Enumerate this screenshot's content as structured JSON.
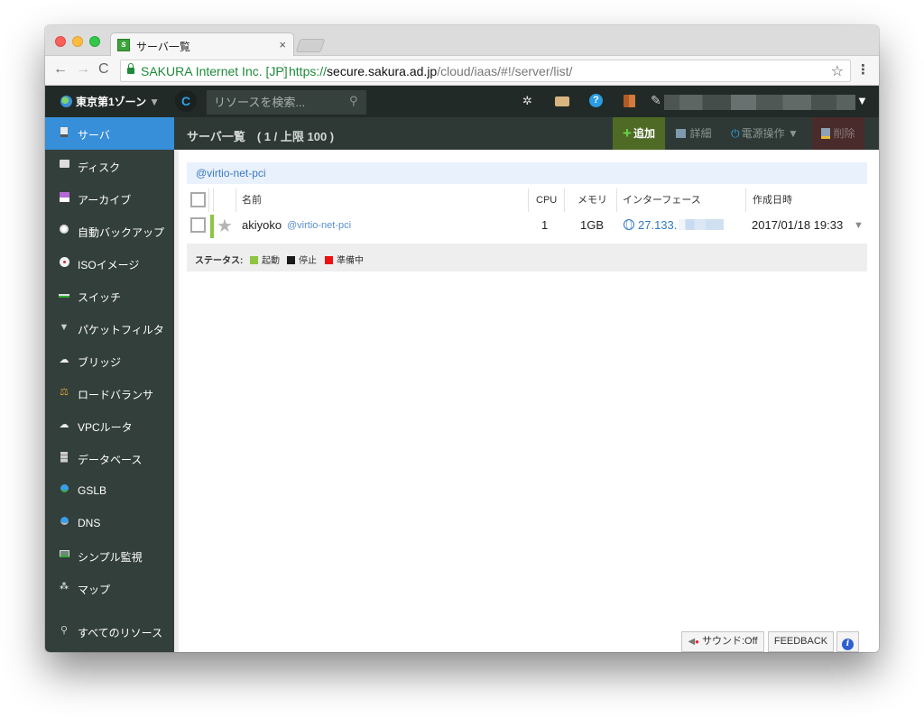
{
  "browser": {
    "tab_title": "サーバ一覧",
    "tab_close": "×",
    "ev_name": "SAKURA Internet Inc. [JP]",
    "url_scheme": "https://",
    "url_host": "secure.sakura.ad.jp",
    "url_path": "/cloud/iaas/#!/server/list/",
    "back": "←",
    "forward": "→",
    "reload": "C",
    "star": "☆",
    "menu": "⋮"
  },
  "topbar": {
    "zone": "東京第1ゾーン",
    "zone_caret": "▼",
    "reload_label": "C",
    "search_placeholder": "リソースを検索...",
    "search_icon": "⚲",
    "gear": "✲",
    "help": "?",
    "feather": "✎",
    "user_caret": "▼"
  },
  "sidebar": {
    "items": [
      {
        "label": "サーバ",
        "icon": "server-icon",
        "active": true
      },
      {
        "label": "ディスク",
        "icon": "disk-icon"
      },
      {
        "label": "アーカイブ",
        "icon": "archive-icon"
      },
      {
        "label": "自動バックアップ",
        "icon": "clock-icon"
      },
      {
        "label": "ISOイメージ",
        "icon": "cd-icon"
      },
      {
        "label": "スイッチ",
        "icon": "switch-icon"
      },
      {
        "label": "パケットフィルタ",
        "icon": "filter-icon"
      },
      {
        "label": "ブリッジ",
        "icon": "bridge-icon"
      },
      {
        "label": "ロードバランサ",
        "icon": "balance-icon"
      },
      {
        "label": "VPCルータ",
        "icon": "router-icon"
      },
      {
        "label": "データベース",
        "icon": "database-icon"
      },
      {
        "label": "GSLB",
        "icon": "gslb-icon"
      },
      {
        "label": "DNS",
        "icon": "dns-icon"
      },
      {
        "label": "シンプル監視",
        "icon": "monitor-icon"
      },
      {
        "label": "マップ",
        "icon": "map-icon"
      },
      {
        "label": "すべてのリソース",
        "icon": "search-icon"
      }
    ]
  },
  "content": {
    "title": "サーバ一覧　( 1 / 上限 100 )",
    "actions": {
      "add": "追加",
      "add_plus": "+",
      "detail": "詳細",
      "power": "電源操作 ▼",
      "power_icon": "⏻",
      "delete": "削除"
    },
    "filter_tag": "@virtio-net-pci",
    "columns": [
      "名前",
      "CPU",
      "メモリ",
      "インターフェース",
      "作成日時"
    ],
    "rows": [
      {
        "name": "akiyoko",
        "tag": "@virtio-net-pci",
        "cpu": "1",
        "memory": "1GB",
        "interface": "27.133.",
        "created": "2017/01/18 19:33",
        "status": "running",
        "starred": false
      }
    ],
    "row_star": "★",
    "row_caret": "▼",
    "legend": {
      "title": "ステータス:",
      "items": [
        {
          "label": "起動",
          "color": "#8dc63f"
        },
        {
          "label": "停止",
          "color": "#1a1a1a"
        },
        {
          "label": "準備中",
          "color": "#ee1111"
        }
      ]
    }
  },
  "footer": {
    "sound": "サウンド:Off",
    "sound_icon": "◀",
    "feedback": "FEEDBACK",
    "info": "i"
  },
  "colors": {
    "accent": "#378ed9",
    "topbar": "#212a27",
    "sidebar": "#323f3a",
    "add_button": "#4e6a25",
    "delete_button": "#4a2b2b"
  }
}
